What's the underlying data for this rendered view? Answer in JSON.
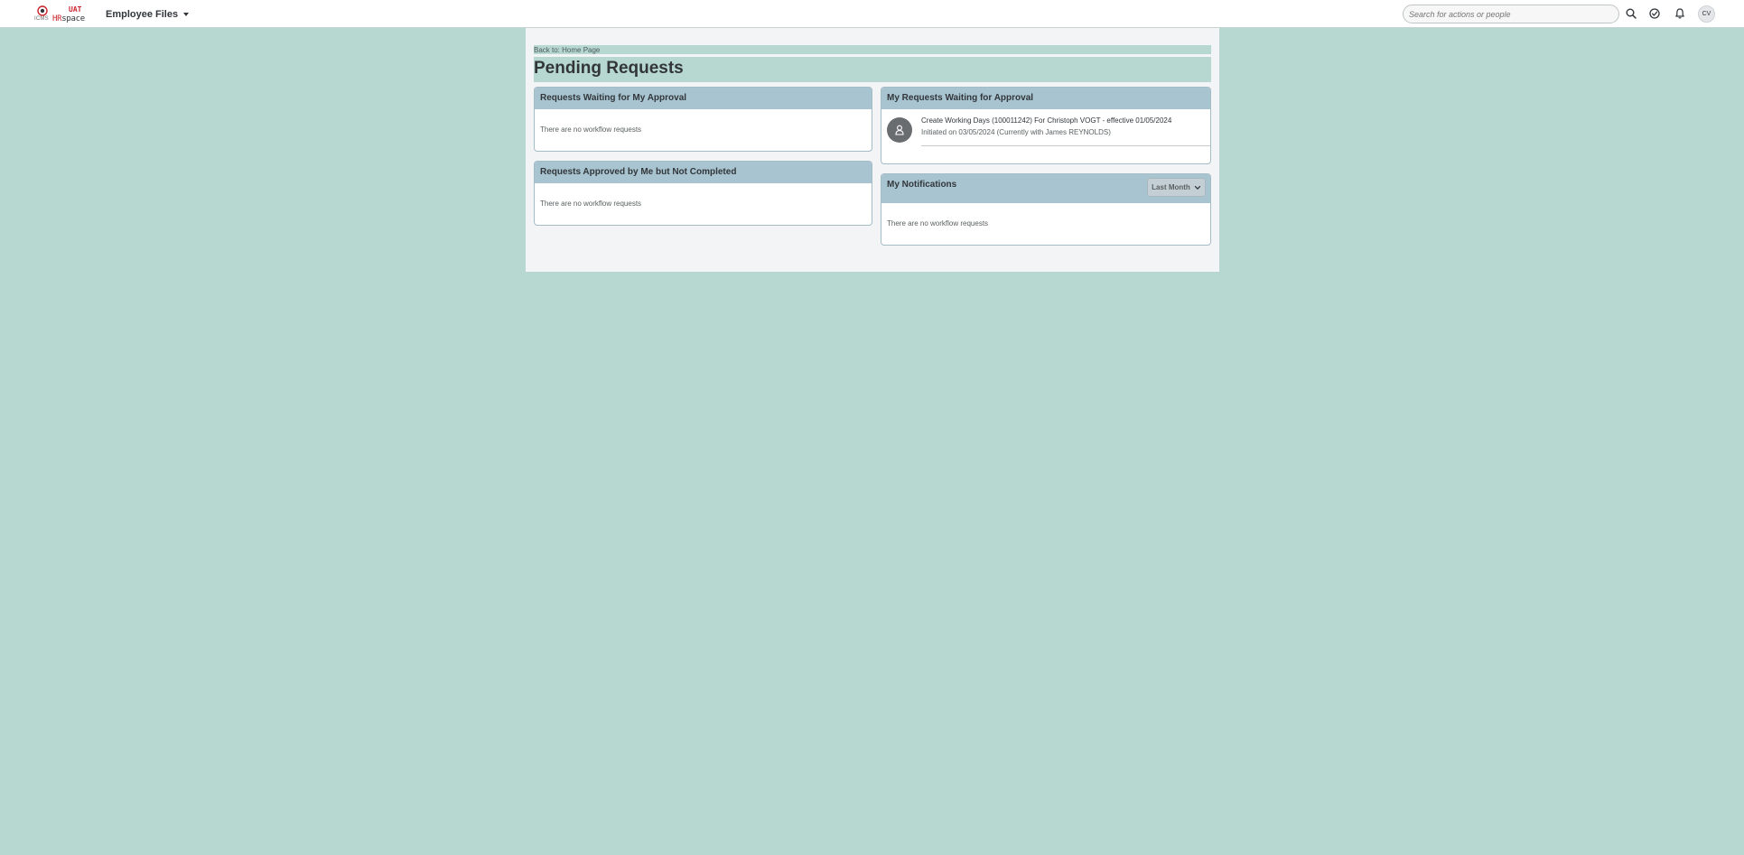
{
  "shell": {
    "logo": {
      "small": "ICMS",
      "uat": "UAT",
      "hr": "HR",
      "space": "space"
    },
    "module_label": "Employee Files",
    "search": {
      "placeholder": "Search for actions or people"
    },
    "icons": [
      "search-icon",
      "approvals-icon",
      "notifications-icon"
    ],
    "user_initials": "CV"
  },
  "page": {
    "back_link": "Back to: Home Page",
    "title": "Pending Requests"
  },
  "panels": {
    "waiting_for_my_approval": {
      "title": "Requests Waiting for My Approval",
      "empty": "There are no workflow requests"
    },
    "approved_not_completed": {
      "title": "Requests Approved by Me but Not Completed",
      "empty": "There are no workflow requests"
    },
    "my_requests": {
      "title": "My Requests Waiting for Approval",
      "items": [
        {
          "title": "Create Working Days (100011242) For Christoph VOGT - effective 01/05/2024",
          "subtitle": "Initiated on 03/05/2024 (Currently with James REYNOLDS)",
          "icon": "person-icon"
        }
      ]
    },
    "notifications": {
      "title": "My Notifications",
      "filter": "Last Month",
      "empty": "There are no workflow requests"
    }
  },
  "colors": {
    "background": "#b7d8d1",
    "panel_header": "#a8c4d0",
    "brand_red": "#c9252c"
  }
}
